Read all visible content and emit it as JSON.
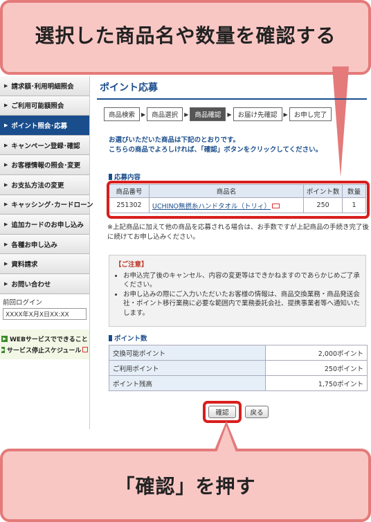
{
  "callouts": {
    "top": "選択した商品名や数量を確認する",
    "bottom": "「確認」を押す"
  },
  "sidebar": {
    "items": [
      {
        "label": "請求額･利用明細照会",
        "active": false
      },
      {
        "label": "ご利用可能額照会",
        "active": false
      },
      {
        "label": "ポイント照会･応募",
        "active": true
      },
      {
        "label": "キャンペーン登録･確認",
        "active": false
      },
      {
        "label": "お客様情報の照会･変更",
        "active": false
      },
      {
        "label": "お支払方法の変更",
        "active": false
      },
      {
        "label": "キャッシング･カードローン",
        "active": false
      },
      {
        "label": "追加カードのお申し込み",
        "active": false
      },
      {
        "label": "各種お申し込み",
        "active": false
      },
      {
        "label": "資料請求",
        "active": false
      },
      {
        "label": "お問い合わせ",
        "active": false
      }
    ],
    "last_login_label": "前回ログイン",
    "last_login_value": "XXXX年X月X日XX:XX",
    "links": [
      {
        "label": "WEBサービスでできること"
      },
      {
        "label": "サービス停止スケジュール"
      }
    ]
  },
  "main": {
    "title": "ポイント応募",
    "steps": [
      "商品検索",
      "商品選択",
      "商品確認",
      "お届け先確認",
      "お申し完了"
    ],
    "active_step": 2,
    "intro_line1": "お選びいただいた商品は下記のとおりです。",
    "intro_line2": "こちらの商品でよろしければ、「確認」ボタンをクリックしてください。",
    "application_section": "応募内容",
    "application_headers": [
      "商品番号",
      "商品名",
      "ポイント数",
      "数量"
    ],
    "application_row": {
      "code": "251302",
      "name": "UCHINO無撚糸ハンドタオル（トリィ）",
      "points": "250",
      "qty": "1"
    },
    "note": "※上記商品に加えて他の商品を応募される場合は、お手数ですが上記商品の手続き完了後に続けてお申し込みください。",
    "notice_title": "【ご注意】",
    "notice_items": [
      "お申込完了後のキャンセル、内容の変更等はできかねますのであらかじめご了承ください。",
      "お申し込みの際にご入力いただいたお客様の情報は、商品交換業務・商品発送会社・ポイント移行業務に必要な範囲内で業務委託会社、提携事業者等へ通知いたします。"
    ],
    "points_section": "ポイント数",
    "points_rows": [
      {
        "label": "交換可能ポイント",
        "value": "2,000ポイント"
      },
      {
        "label": "ご利用ポイント",
        "value": "250ポイント"
      },
      {
        "label": "ポイント残高",
        "value": "1,750ポイント"
      }
    ],
    "confirm_label": "確認",
    "back_label": "戻る"
  },
  "colors": {
    "accent": "#1a4d8c",
    "highlight": "#d81e1e",
    "callout_fill": "#f8c7c4",
    "callout_border": "#e47a7a"
  }
}
